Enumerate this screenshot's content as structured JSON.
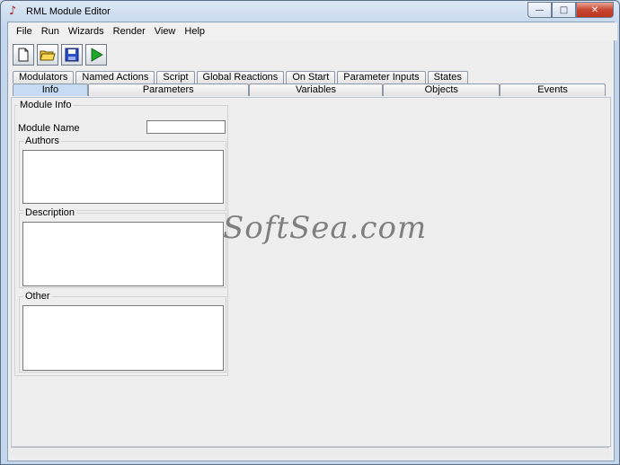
{
  "window": {
    "title": "RML Module Editor",
    "app_icon": "music-note-icon",
    "controls": {
      "minimize": "—",
      "maximize": "□",
      "close": "✕"
    }
  },
  "menubar": [
    "File",
    "Run",
    "Wizards",
    "Render",
    "View",
    "Help"
  ],
  "toolbar": {
    "buttons": [
      "new-file-icon",
      "open-folder-icon",
      "save-disk-icon",
      "run-play-icon"
    ]
  },
  "tabs_row1": [
    "Modulators",
    "Named Actions",
    "Script",
    "Global Reactions",
    "On Start",
    "Parameter Inputs",
    "States"
  ],
  "tabs_row2": [
    "Info",
    "Parameters",
    "Variables",
    "Objects",
    "Events"
  ],
  "active_tab": "Info",
  "info": {
    "group_title": "Module Info",
    "module_name_label": "Module Name",
    "module_name_value": "",
    "authors_title": "Authors",
    "description_title": "Description",
    "other_title": "Other"
  },
  "watermark": "SoftSea.com",
  "colors": {
    "accent_tab": "#c7dcf3",
    "close_button": "#c8452f",
    "play_green": "#1fa82a"
  }
}
